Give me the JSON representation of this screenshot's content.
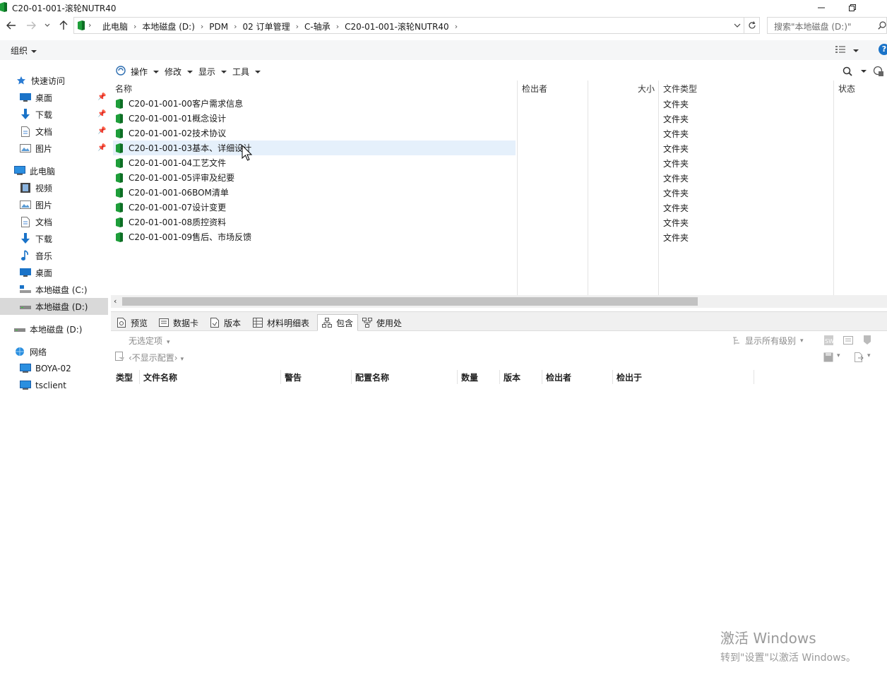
{
  "window": {
    "title": "C20-01-001-滚轮NUTR40"
  },
  "address": {
    "crumbs": [
      "此电脑",
      "本地磁盘 (D:)",
      "PDM",
      "02 订单管理",
      "C-轴承",
      "C20-01-001-滚轮NUTR40"
    ],
    "search_placeholder": "搜索\"本地磁盘 (D:)\""
  },
  "commandbar": {
    "organize": "组织"
  },
  "sidebar": {
    "quick_access": "快速访问",
    "quick_items": [
      "桌面",
      "下载",
      "文档",
      "图片"
    ],
    "this_pc": "此电脑",
    "pc_items": [
      "视频",
      "图片",
      "文档",
      "下载",
      "音乐",
      "桌面",
      "本地磁盘 (C:)",
      "本地磁盘 (D:)"
    ],
    "drive_d": "本地磁盘 (D:)",
    "network": "网络",
    "network_items": [
      "BOYA-02",
      "tsclient"
    ]
  },
  "pdm_toolbar": {
    "menus": [
      "操作",
      "修改",
      "显示",
      "工具"
    ]
  },
  "file_list": {
    "columns": [
      "名称",
      "检出者",
      "大小",
      "文件类型",
      "状态"
    ],
    "rows": [
      {
        "name": "C20-01-001-00客户需求信息",
        "type": "文件夹"
      },
      {
        "name": "C20-01-001-01概念设计",
        "type": "文件夹"
      },
      {
        "name": "C20-01-001-02技术协议",
        "type": "文件夹"
      },
      {
        "name": "C20-01-001-03基本、详细设计",
        "type": "文件夹"
      },
      {
        "name": "C20-01-001-04工艺文件",
        "type": "文件夹"
      },
      {
        "name": "C20-01-001-05评审及纪要",
        "type": "文件夹"
      },
      {
        "name": "C20-01-001-06BOM清单",
        "type": "文件夹"
      },
      {
        "name": "C20-01-001-07设计变更",
        "type": "文件夹"
      },
      {
        "name": "C20-01-001-08质控资料",
        "type": "文件夹"
      },
      {
        "name": "C20-01-001-09售后、市场反馈",
        "type": "文件夹"
      }
    ]
  },
  "detail_tabs": [
    "预览",
    "数据卡",
    "版本",
    "材料明细表",
    "包含",
    "使用处"
  ],
  "detail_options": {
    "no_option": "无选定项",
    "no_config": "‹不显示配置›",
    "show_levels": "显示所有级别"
  },
  "detail_columns": [
    "类型",
    "文件名称",
    "警告",
    "配置名称",
    "数量",
    "版本",
    "检出者",
    "检出于"
  ],
  "watermark": {
    "line1": "激活 Windows",
    "line2": "转到\"设置\"以激活 Windows。"
  }
}
